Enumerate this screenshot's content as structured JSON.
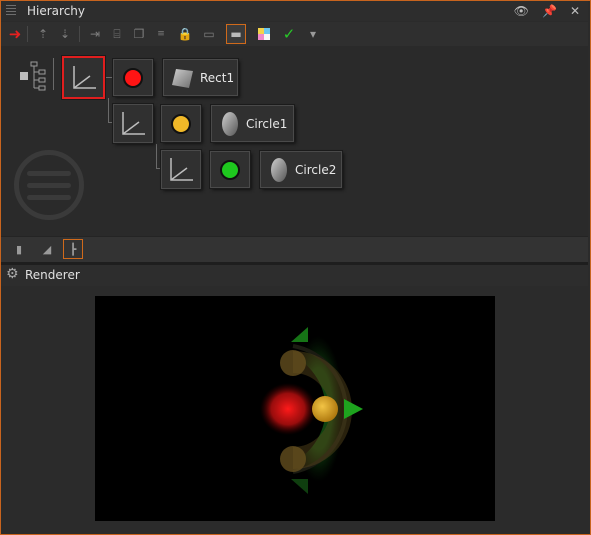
{
  "hierarchy_panel": {
    "title": "Hierarchy",
    "header_icons": [
      "eye-icon",
      "pin-icon",
      "close-icon"
    ]
  },
  "toolbar": {
    "icons": [
      "red-arrow-icon",
      "move-up-icon",
      "move-down-icon",
      "indent-icon",
      "group-icon",
      "duplicate-icon",
      "script-icon",
      "lock-icon",
      "comment-icon",
      "comment-filled-icon",
      "palette-icon",
      "check-icon",
      "bookmark-icon"
    ]
  },
  "nodes": {
    "rect1": "Rect1",
    "circle1": "Circle1",
    "circle2": "Circle2"
  },
  "colors": {
    "accent": "#d06a1b",
    "selection": "#e01e1e",
    "rect_fill": "#ff1414",
    "circle1_fill": "#f0b828",
    "circle2_fill": "#1ec81e"
  },
  "renderer_panel": {
    "title": "Renderer"
  }
}
